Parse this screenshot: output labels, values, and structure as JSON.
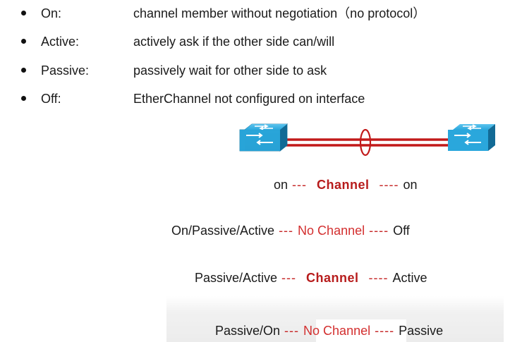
{
  "bullets": [
    {
      "term": "On:",
      "desc": "channel member without negotiation（no protocol）"
    },
    {
      "term": "Active:",
      "desc": "actively ask if the other side can/will"
    },
    {
      "term": "Passive:",
      "desc": "passively wait for other side to ask"
    },
    {
      "term": "Off:",
      "desc": "EtherChannel not configured on interface"
    }
  ],
  "diagram": {
    "switch_color": "#2aa7dc",
    "link_color": "#c21a1a"
  },
  "modes": [
    {
      "left": "on",
      "sep1": " --- ",
      "result": "Channel",
      "result_type": "channel",
      "sep2": " ---- ",
      "right": "on"
    },
    {
      "left": "On/Passive/Active",
      "sep1": " --- ",
      "result": "No Channel",
      "result_type": "nochannel",
      "sep2": " ---- ",
      "right": "Off"
    },
    {
      "left": "Passive/Active",
      "sep1": " --- ",
      "result": "Channel",
      "result_type": "channel",
      "sep2": " ---- ",
      "right": "Active"
    },
    {
      "left": "Passive/On",
      "sep1": " --- ",
      "result": "No Channel",
      "result_type": "nochannel",
      "sep2": " ---- ",
      "right": "Passive"
    }
  ]
}
